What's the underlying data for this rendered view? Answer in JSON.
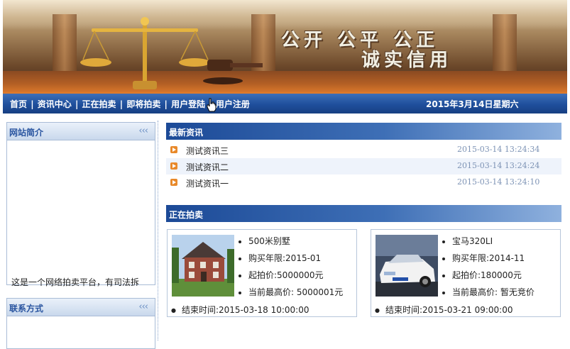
{
  "banner": {
    "slogan_line1": "公开 公平 公正",
    "slogan_line2": "诚实信用"
  },
  "nav": {
    "items": [
      "首页",
      "资讯中心",
      "正在拍卖",
      "即将拍卖",
      "用户登陆",
      "用户注册"
    ],
    "date": "2015年3月14日星期六"
  },
  "sidebar": {
    "intro_title": "网站简介",
    "intro_arrows": "‹‹‹",
    "intro_text": "这是一个网络拍卖平台，有司法拆",
    "contact_title": "联系方式",
    "contact_arrows": "‹‹‹"
  },
  "news": {
    "title": "最新资讯",
    "items": [
      {
        "title": "测试资讯三",
        "time": "2015-03-14 13:24:34"
      },
      {
        "title": "测试资讯二",
        "time": "2015-03-14 13:24:24"
      },
      {
        "title": "测试资讯一",
        "time": "2015-03-14 13:24:10"
      }
    ]
  },
  "auction": {
    "title": "正在拍卖",
    "items": [
      {
        "name": "500米别墅",
        "years": "购买年限:2015-01",
        "start_price": "起拍价:5000000元",
        "current_price": "当前最高价: 5000001元",
        "end_time": "结束时间:2015-03-18 10:00:00",
        "image": "house-photo"
      },
      {
        "name": "宝马320LI",
        "years": "购买年限:2014-11",
        "start_price": "起拍价:180000元",
        "current_price": "当前最高价: 暂无竞价",
        "end_time": "结束时间:2015-03-21 09:00:00",
        "image": "car-photo"
      }
    ]
  },
  "colors": {
    "nav_blue": "#1f4f9c",
    "accent_orange": "#e07a2a",
    "title_blue": "#2a55a0",
    "time_gray": "#7d93b5"
  }
}
